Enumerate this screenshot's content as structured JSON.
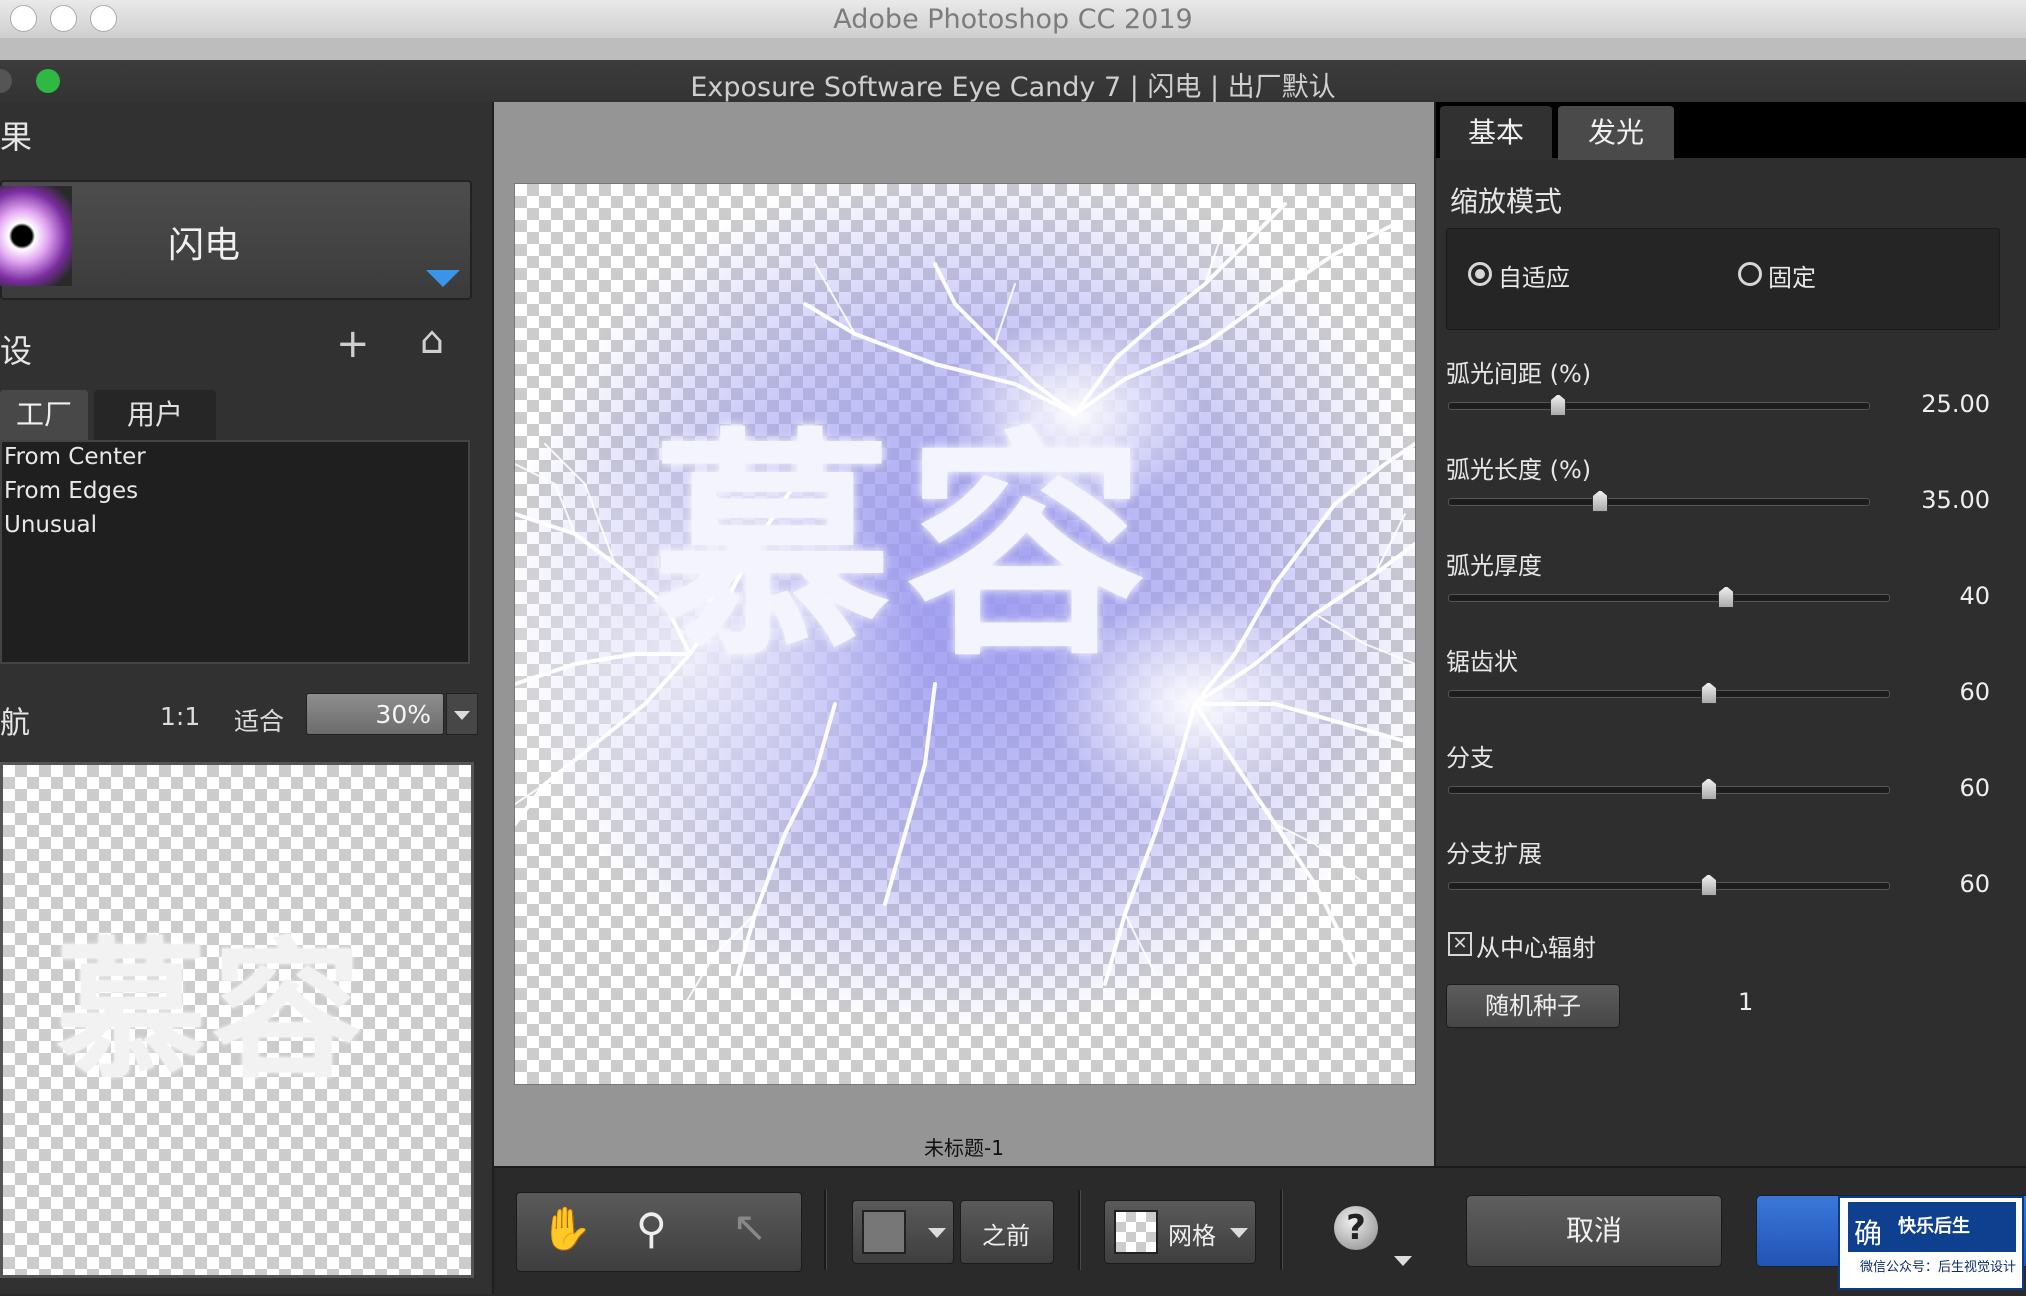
{
  "mac": {
    "title": "Adobe Photoshop CC 2019"
  },
  "plugin": {
    "title": "Exposure Software Eye Candy 7 | 闪电 | 出厂默认"
  },
  "left": {
    "effects_heading": "果",
    "effect_name": "闪电",
    "presets_heading": "设",
    "tabs": [
      "工厂",
      "用户"
    ],
    "presets": [
      "From Center",
      "From Edges",
      "Unusual"
    ],
    "nav_heading": "航",
    "nav_1to1": "1:1",
    "nav_fit": "适合",
    "zoom_value": "30%",
    "preview_text": "慕容"
  },
  "canvas": {
    "text": "慕容",
    "doc_name": "未标题-1"
  },
  "right": {
    "tabs": [
      "基本",
      "发光"
    ],
    "zoom_mode_label": "缩放模式",
    "radio_adaptive": "自适应",
    "radio_fixed": "固定",
    "sliders": [
      {
        "label": "弧光间距 (%)",
        "value": "25.00",
        "fraction": 0.26
      },
      {
        "label": "弧光长度 (%)",
        "value": "35.00",
        "fraction": 0.36
      },
      {
        "label": "弧光厚度",
        "value": "40",
        "fraction": 0.63
      },
      {
        "label": "锯齿状",
        "value": "60",
        "fraction": 0.59
      },
      {
        "label": "分支",
        "value": "60",
        "fraction": 0.59
      },
      {
        "label": "分支扩展",
        "value": "60",
        "fraction": 0.59
      }
    ],
    "checkbox_label": "从中心辐射",
    "checkbox_checked": true,
    "seed_button": "随机种子",
    "seed_value": "1"
  },
  "toolbar": {
    "before_label": "之前",
    "grid_label": "网格"
  },
  "buttons": {
    "cancel": "取消",
    "ok": "确"
  },
  "watermark": {
    "line1": "快乐后生",
    "line2": "微信公众号：后生视觉设计"
  }
}
